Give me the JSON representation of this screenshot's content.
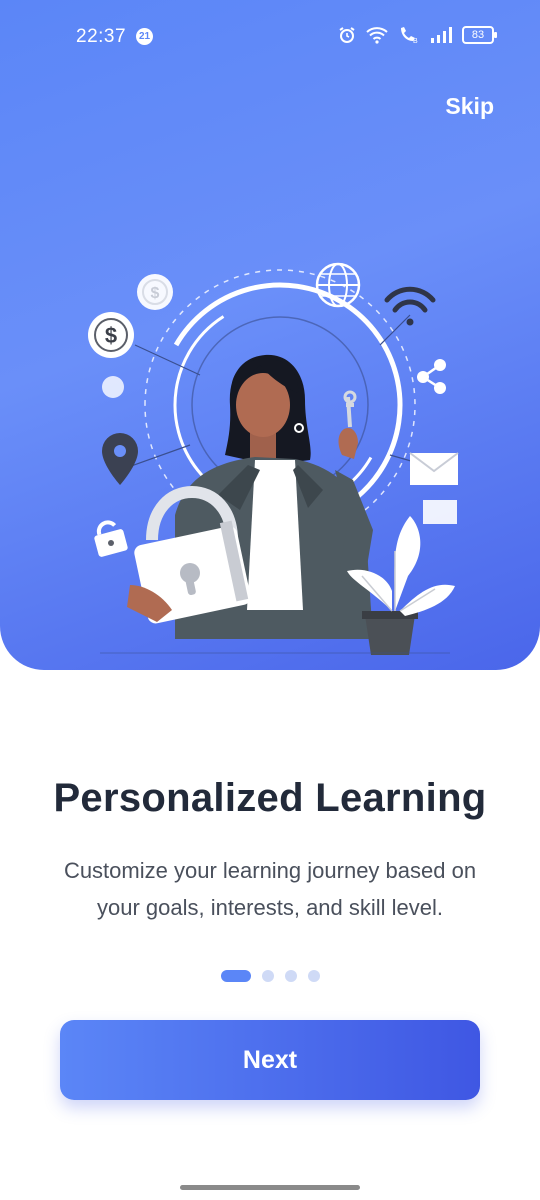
{
  "status_bar": {
    "time": "22:37",
    "badge": "21",
    "battery": "83",
    "icons": [
      "alarm-icon",
      "wifi-icon",
      "call-icon",
      "signal-icon",
      "battery-icon"
    ]
  },
  "header": {
    "skip_label": "Skip"
  },
  "onboarding": {
    "title": "Personalized Learning",
    "description": "Customize your learning journey based on your goals, interests, and skill level.",
    "page_indicator": {
      "current": 1,
      "total": 4
    },
    "next_label": "Next"
  },
  "colors": {
    "accent": "#5b86f7",
    "accent_dark": "#3f57e3",
    "title_text": "#222a3a",
    "body_text": "#4a505c"
  }
}
